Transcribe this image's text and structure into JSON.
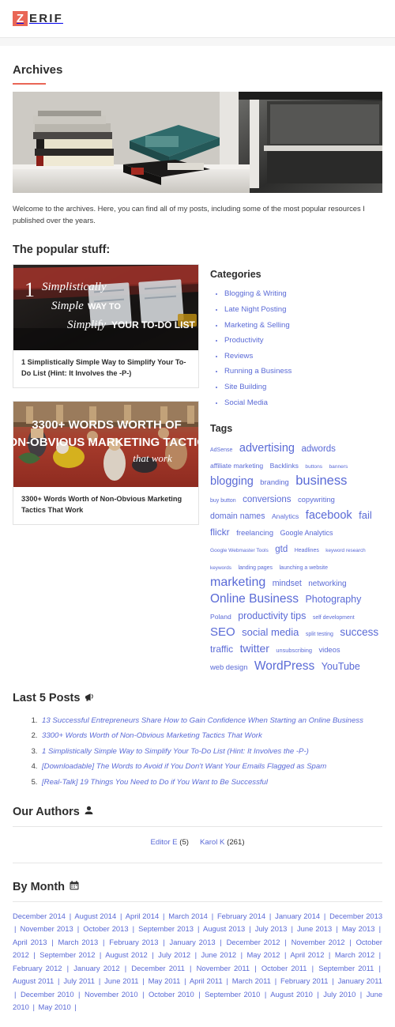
{
  "header": {
    "logo_mark": "Z",
    "logo_rest": "ERIF"
  },
  "page": {
    "title": "Archives",
    "intro": "Welcome to the archives. Here, you can find all of my posts, including some of the most popular resources I published over the years.",
    "hero_alt": "books-on-windowsill-photo"
  },
  "popular": {
    "heading": "The popular stuff:",
    "posts": [
      {
        "caption": "1 Simplistically Simple Way to Simplify Your To-Do List (Hint: It Involves the -P-)",
        "thumb_line1": "Simplistically",
        "thumb_line2": "Simple",
        "thumb_line2b": "WAY TO",
        "thumb_line3": "Simplify",
        "thumb_line3b": "YOUR TO-DO LIST",
        "thumb_number": "1"
      },
      {
        "caption": "3300+ Words Worth of Non-Obvious Marketing Tactics That Work",
        "thumb_line1": "3300+ WORDS WORTH OF",
        "thumb_line2": "NON-OBVIOUS MARKETING TACTICS",
        "thumb_line3": "that work"
      }
    ]
  },
  "categories": {
    "heading": "Categories",
    "items": [
      "Blogging & Writing",
      "Late Night Posting",
      "Marketing & Selling",
      "Productivity",
      "Reviews",
      "Running a Business",
      "Site Building",
      "Social Media"
    ]
  },
  "tags": {
    "heading": "Tags",
    "items": [
      {
        "label": "AdSense",
        "size": 7
      },
      {
        "label": "advertising",
        "size": 14.5
      },
      {
        "label": "adwords",
        "size": 11.5
      },
      {
        "label": "affiliate marketing",
        "size": 8.6
      },
      {
        "label": "Backlinks",
        "size": 8.6
      },
      {
        "label": "buttons",
        "size": 6.6
      },
      {
        "label": "banners",
        "size": 6.6
      },
      {
        "label": "blogging",
        "size": 14.5
      },
      {
        "label": "branding",
        "size": 9.4
      },
      {
        "label": "business",
        "size": 16.5
      },
      {
        "label": "buy button",
        "size": 7
      },
      {
        "label": "conversions",
        "size": 11.5
      },
      {
        "label": "copywriting",
        "size": 9.4
      },
      {
        "label": "domain names",
        "size": 10.6
      },
      {
        "label": "Analytics",
        "size": 8.6
      },
      {
        "label": "facebook",
        "size": 14.5
      },
      {
        "label": "fail",
        "size": 13
      },
      {
        "label": "flickr",
        "size": 12
      },
      {
        "label": "freelancing",
        "size": 9.6
      },
      {
        "label": "Google Analytics",
        "size": 9
      },
      {
        "label": "Google Webmaster Tools",
        "size": 6.6
      },
      {
        "label": "gtd",
        "size": 11.5
      },
      {
        "label": "Headlines",
        "size": 7
      },
      {
        "label": "keyword research",
        "size": 6.4
      },
      {
        "label": "keywords",
        "size": 6.4
      },
      {
        "label": "landing pages",
        "size": 7
      },
      {
        "label": "launching a website",
        "size": 7
      },
      {
        "label": "marketing",
        "size": 16
      },
      {
        "label": "mindset",
        "size": 10.6
      },
      {
        "label": "networking",
        "size": 10
      },
      {
        "label": "Online Business",
        "size": 15.5
      },
      {
        "label": "Photography",
        "size": 12.5
      },
      {
        "label": "Poland",
        "size": 8.6
      },
      {
        "label": "productivity tips",
        "size": 12.5
      },
      {
        "label": "self development",
        "size": 7
      },
      {
        "label": "SEO",
        "size": 15
      },
      {
        "label": "social media",
        "size": 13
      },
      {
        "label": "split testing",
        "size": 7
      },
      {
        "label": "success",
        "size": 13.5
      },
      {
        "label": "traffic",
        "size": 12
      },
      {
        "label": "twitter",
        "size": 14
      },
      {
        "label": "unsubscribing",
        "size": 7.4
      },
      {
        "label": "videos",
        "size": 9.4
      },
      {
        "label": "web design",
        "size": 9.4
      },
      {
        "label": "WordPress",
        "size": 15.5
      },
      {
        "label": "YouTube",
        "size": 12.5
      }
    ]
  },
  "last_posts": {
    "heading": "Last 5 Posts",
    "icon": "megaphone-icon",
    "items": [
      "13 Successful Entrepreneurs Share How to Gain Confidence When Starting an Online Business",
      "3300+ Words Worth of Non-Obvious Marketing Tactics That Work",
      "1 Simplistically Simple Way to Simplify Your To-Do List (Hint: It Involves the -P-)",
      "[Downloadable] The Words to Avoid if You Don't Want Your Emails Flagged as Spam",
      "[Real-Talk] 19 Things You Need to Do if You Want to Be Successful"
    ]
  },
  "authors": {
    "heading": "Our Authors",
    "icon": "user-icon",
    "items": [
      {
        "name": "Editor E",
        "count": "(5)"
      },
      {
        "name": "Karol K",
        "count": "(261)"
      }
    ]
  },
  "by_month": {
    "heading": "By Month",
    "icon": "calendar-icon",
    "separator": "|",
    "items": [
      "December 2014",
      "August 2014",
      "April 2014",
      "March 2014",
      "February 2014",
      "January 2014",
      "December 2013",
      "November 2013",
      "October 2013",
      "September 2013",
      "August 2013",
      "July 2013",
      "June 2013",
      "May 2013",
      "April 2013",
      "March 2013",
      "February 2013",
      "January 2013",
      "December 2012",
      "November 2012",
      "October 2012",
      "September 2012",
      "August 2012",
      "July 2012",
      "June 2012",
      "May 2012",
      "April 2012",
      "March 2012",
      "February 2012",
      "January 2012",
      "December 2011",
      "November 2011",
      "October 2011",
      "September 2011",
      "August 2011",
      "July 2011",
      "June 2011",
      "May 2011",
      "April 2011",
      "March 2011",
      "February 2011",
      "January 2011",
      "December 2010",
      "November 2010",
      "October 2010",
      "September 2010",
      "August 2010",
      "July 2010",
      "June 2010",
      "May 2010"
    ]
  },
  "colors": {
    "accent": "#e96656",
    "link": "#5a6ad6",
    "text": "#2d2d2d"
  }
}
